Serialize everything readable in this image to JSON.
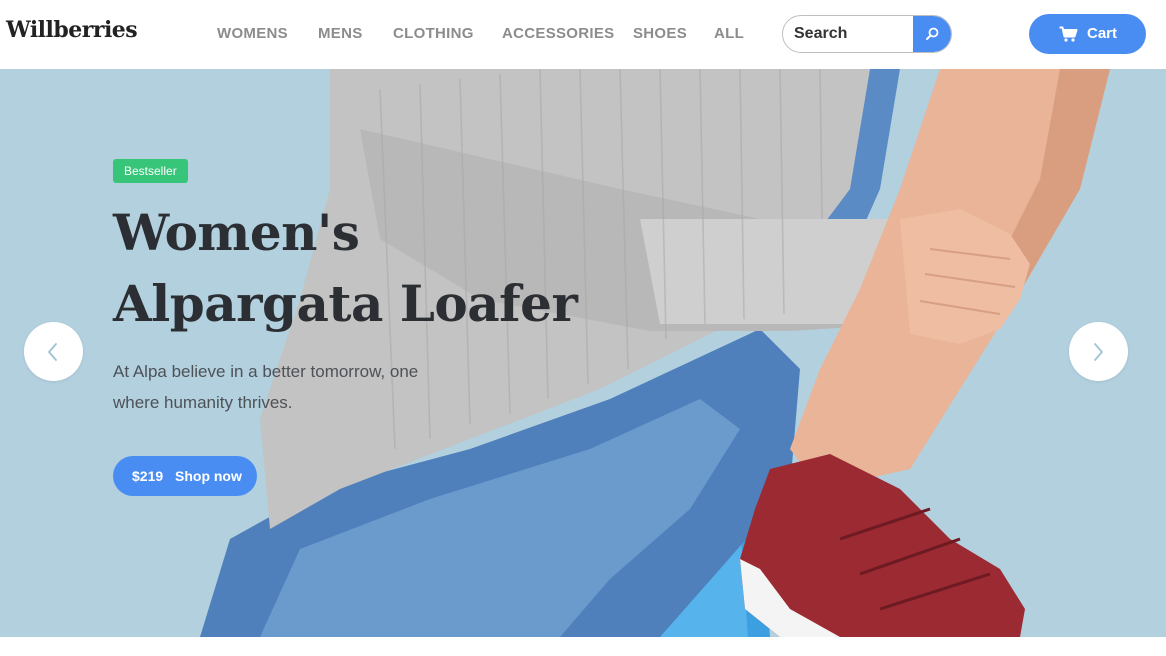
{
  "header": {
    "logo": "Willberries",
    "nav": [
      "WOMENS",
      "MENS",
      "CLOTHING",
      "ACCESSORIES",
      "SHOES",
      "ALL"
    ],
    "search": {
      "placeholder": "Search",
      "button_icon": "search-icon"
    },
    "cart": {
      "icon": "cart-icon",
      "label": "Cart"
    }
  },
  "hero": {
    "badge": "Bestseller",
    "title_line1": "Women's",
    "title_line2": "Alpargata Loafer",
    "description": "At Alpa believe in a better tomorrow, one where humanity thrives.",
    "cta": {
      "price": "$219",
      "label": "Shop now"
    },
    "prev_icon": "chevron-left-icon",
    "next_icon": "chevron-right-icon"
  },
  "colors": {
    "accent": "#4a8df2",
    "badge": "#37c57a",
    "hero_background": "#b3d0df",
    "title": "#2b2f33",
    "nav": "#8c8c8c"
  }
}
